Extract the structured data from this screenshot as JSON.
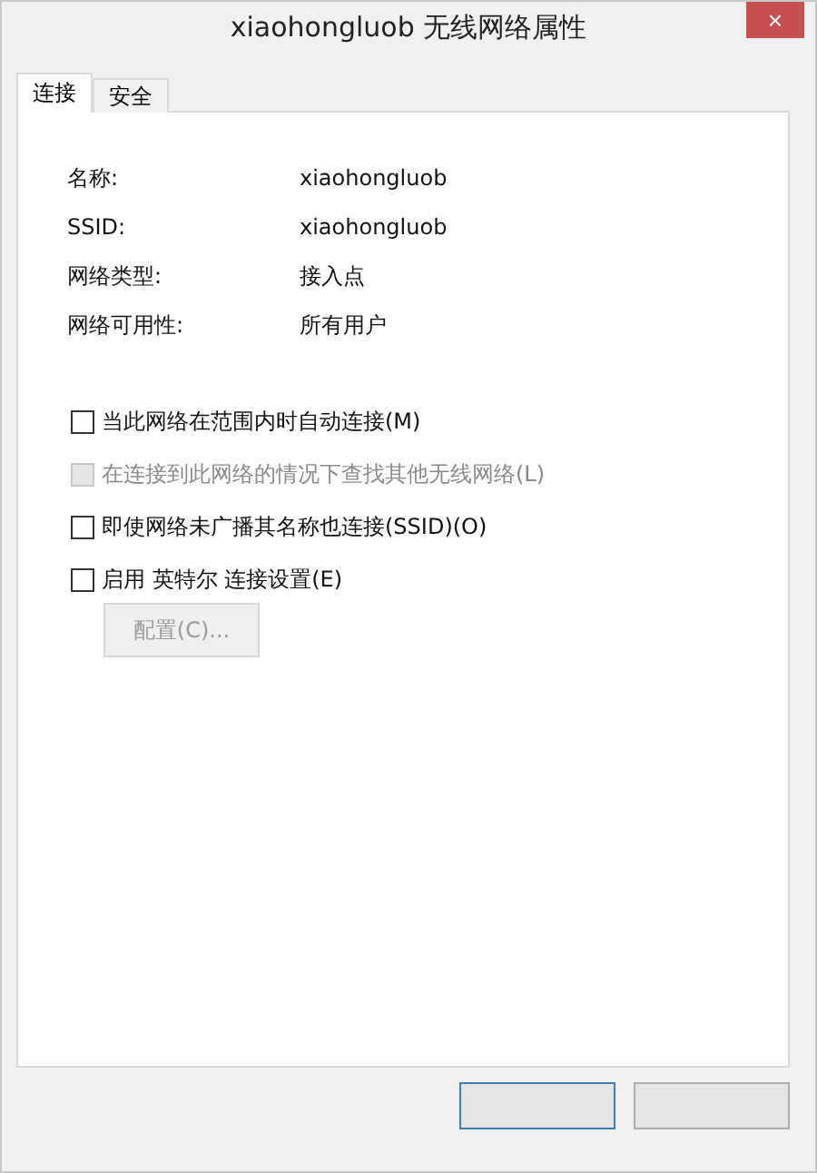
{
  "window": {
    "title": "xiaohongluob 无线网络属性",
    "close": "×"
  },
  "tabs": [
    {
      "label": "连接",
      "selected": true
    },
    {
      "label": "安全",
      "selected": false
    }
  ],
  "properties": [
    {
      "label": "名称:",
      "value": "xiaohongluob"
    },
    {
      "label": "SSID:",
      "value": "xiaohongluob"
    },
    {
      "label": "网络类型:",
      "value": "接入点"
    },
    {
      "label": "网络可用性:",
      "value": "所有用户"
    }
  ],
  "options": [
    {
      "label": "当此网络在范围内时自动连接(M)",
      "checked": false,
      "disabled": false
    },
    {
      "label": "在连接到此网络的情况下查找其他无线网络(L)",
      "checked": false,
      "disabled": true
    },
    {
      "label": "即使网络未广播其名称也连接(SSID)(O)",
      "checked": false,
      "disabled": false
    },
    {
      "label": "启用 英特尔 连接设置(E)",
      "checked": false,
      "disabled": false
    }
  ],
  "configure_button": {
    "label": "配置(C)...",
    "disabled": true
  },
  "dialog_buttons": [
    {
      "default": true
    },
    {
      "default": false
    }
  ]
}
